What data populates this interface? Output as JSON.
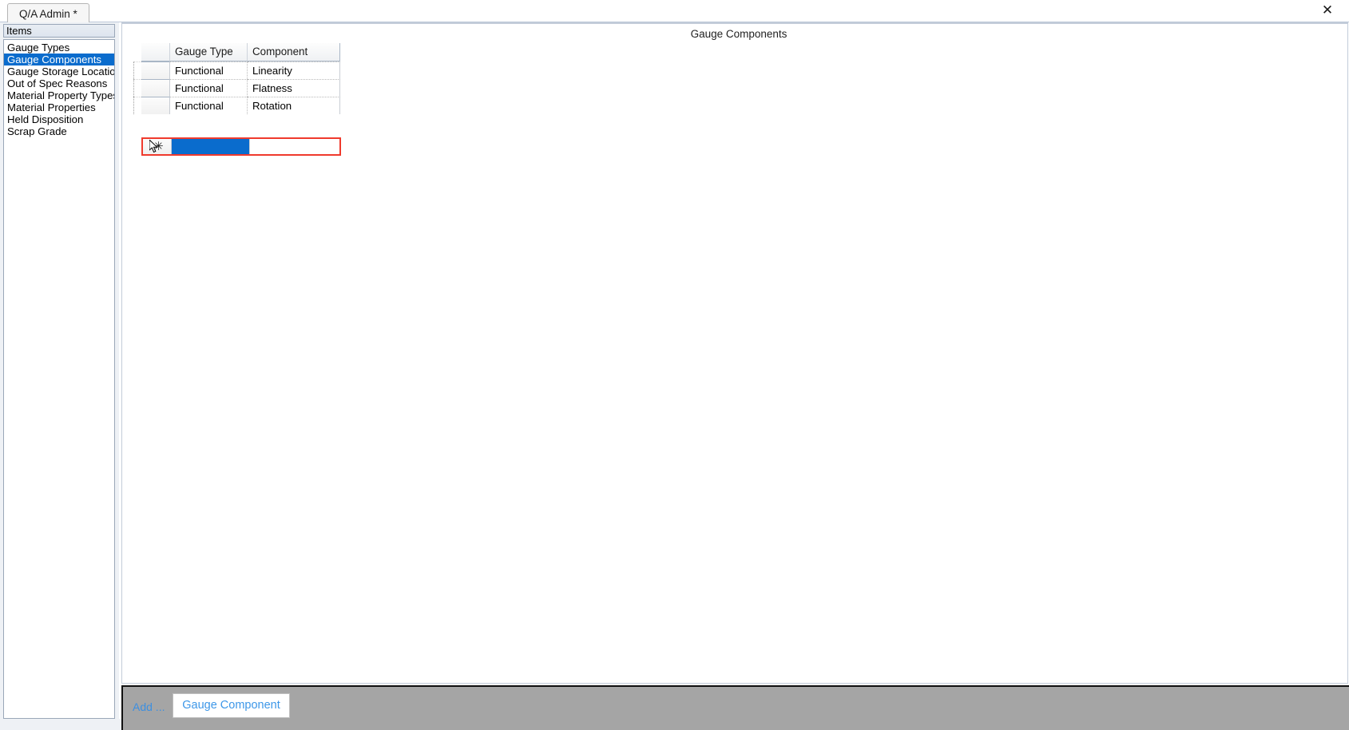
{
  "window": {
    "close_icon": "✕"
  },
  "tabs": [
    {
      "label": "Q/A Admin *"
    }
  ],
  "sidebar": {
    "header": "Items",
    "items": [
      {
        "label": "Gauge Types",
        "selected": false
      },
      {
        "label": "Gauge Components",
        "selected": true
      },
      {
        "label": "Gauge Storage Locations",
        "selected": false
      },
      {
        "label": "Out of Spec Reasons",
        "selected": false
      },
      {
        "label": "Material Property Types",
        "selected": false
      },
      {
        "label": "Material Properties",
        "selected": false
      },
      {
        "label": "Held Disposition",
        "selected": false
      },
      {
        "label": "Scrap Grade",
        "selected": false
      }
    ]
  },
  "main": {
    "title": "Gauge Components",
    "grid": {
      "columns": [
        "Gauge Type",
        "Component"
      ],
      "rows": [
        [
          "Functional",
          "Linearity"
        ],
        [
          "Functional",
          "Flatness"
        ],
        [
          "Functional",
          "Rotation"
        ]
      ],
      "new_row": {
        "indicator": "✳",
        "gauge_type": "",
        "component": "",
        "highlight_color": "#0a6ccd",
        "border_color": "#ef3a2d"
      }
    }
  },
  "bottom_toolbar": {
    "add_label": "Add ...",
    "add_button_label": "Gauge Component"
  }
}
